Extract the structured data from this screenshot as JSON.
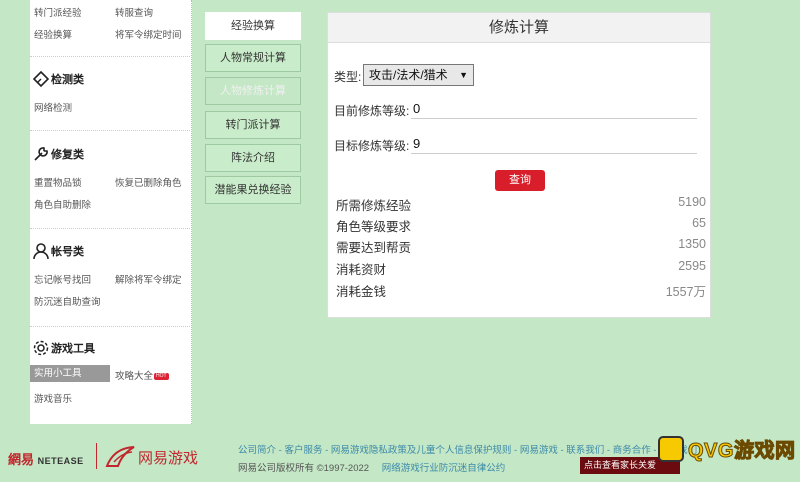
{
  "sidebar": {
    "top_links": [
      "转门派经验",
      "转服查询",
      "经验换算",
      "将军令绑定时间"
    ],
    "sections": [
      {
        "title": "检测类",
        "icon": "scan-icon",
        "links": [
          "网络检测"
        ]
      },
      {
        "title": "修复类",
        "icon": "wrench-icon",
        "links": [
          "重置物品锁",
          "恢复已删除角色",
          "角色自助删除"
        ]
      },
      {
        "title": "帐号类",
        "icon": "user-icon",
        "links": [
          "忘记帐号找回",
          "解除将军令绑定",
          "防沉迷自助查询"
        ]
      },
      {
        "title": "游戏工具",
        "icon": "gear-icon",
        "links": [
          "实用小工具",
          "攻略大全",
          "游戏音乐"
        ],
        "active": "实用小工具",
        "badge": "HOT"
      }
    ]
  },
  "midnav": {
    "items": [
      "经验换算",
      "人物常规计算",
      "人物修炼计算",
      "转门派计算",
      "阵法介绍",
      "潜能果兑换经验"
    ],
    "active": "经验换算"
  },
  "panel": {
    "title": "修炼计算",
    "type_label": "类型:",
    "type_value": "攻击/法术/猎术",
    "current_label": "目前修炼等级:",
    "current_value": "0",
    "target_label": "目标修炼等级:",
    "target_value": "9",
    "query_label": "查询",
    "results": [
      {
        "label": "所需修炼经验",
        "value": "5190"
      },
      {
        "label": "角色等级要求",
        "value": "65"
      },
      {
        "label": "需要达到帮贡",
        "value": "1350"
      },
      {
        "label": "消耗资财",
        "value": "2595"
      },
      {
        "label": "消耗金钱",
        "value": "1557万"
      }
    ]
  },
  "footer": {
    "logo1": "網易",
    "logo1_en": "NETEASE",
    "logo2": "网易游戏",
    "links": "公司简介 - 客户服务 - 网易游戏隐私政策及儿童个人信息保护规则 - 网易游戏 - 联系我们 - 商务合作 - 加入我们",
    "copyright": "网易公司版权所有 ©1997-2022",
    "copyright_link": "网络游戏行业防沉迷自律公约",
    "parent_button": "点击查看家长关爱",
    "watermark": "QVG游戏网"
  },
  "colors": {
    "background": "#c4e7c6",
    "accent": "#d81e2b",
    "link": "#3c8aa8"
  }
}
